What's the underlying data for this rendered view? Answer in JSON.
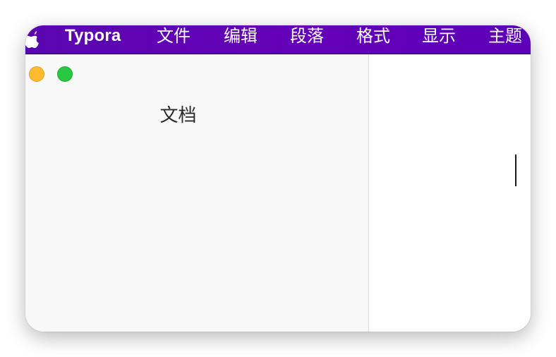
{
  "menubar": {
    "apple_icon": "apple-logo",
    "app_name": "Typora",
    "items": [
      {
        "label": "文件"
      },
      {
        "label": "编辑"
      },
      {
        "label": "段落"
      },
      {
        "label": "格式"
      },
      {
        "label": "显示"
      },
      {
        "label": "主题"
      }
    ],
    "background_color": "#6000b8"
  },
  "sidebar": {
    "title": "文档",
    "window_controls": [
      "minimize",
      "zoom"
    ],
    "background_color": "#f8f8f8"
  },
  "editor": {
    "content": "",
    "cursor_visible": true
  }
}
